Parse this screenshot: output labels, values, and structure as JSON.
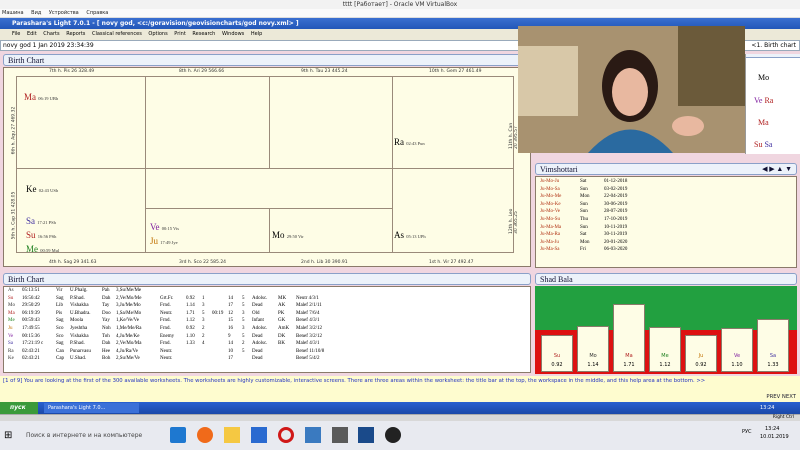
{
  "vbox": {
    "title": "tttt [Работает] - Oracle VM VirtualBox",
    "menu": [
      "Машина",
      "Вид",
      "Устройства",
      "Справка"
    ]
  },
  "app": {
    "title": "Parashara's Light 7.0.1 - [ novy god,  <c:/goravision/geovisioncharts/god novy.xml> ]",
    "menu": [
      "File",
      "Edit",
      "Charts",
      "Reports",
      "Classical references",
      "Options",
      "Print",
      "Research",
      "Windows",
      "Help"
    ],
    "address": "novy god 1 Jan 2019 23:34:39",
    "nav_label": "<1. Birth chart"
  },
  "birth_chart": {
    "title": "Birth Chart",
    "top_headers": [
      "7th h.  Pis  26  328.49",
      "8th h.  Ari  29  566.66",
      "9th h.  Tau  23  445.24",
      "10th h.  Gem  27  461.49"
    ],
    "bottom_headers": [
      "4th h.  Sag  29  341.63",
      "3rd h.  Sco  22  585.24",
      "2nd h.  Lib  30  390.91",
      "1st h.  Vir  27  492.47"
    ],
    "left_headers": [
      "6th h.  Aqu  27  469.32",
      "5th h.  Cap  31  428.05"
    ],
    "right_headers": [
      "11th h.  Can  20  395.57",
      "12th h.  Leo  30  365.25"
    ],
    "planets": [
      {
        "abbr": "Ma",
        "info": "06:19 UBh",
        "color": "#b02020"
      },
      {
        "abbr": "Ra",
        "info": "02:43 Pun",
        "color": "#333"
      },
      {
        "abbr": "Ke",
        "info": "02:43 USh",
        "color": "#333"
      },
      {
        "abbr": "Sa",
        "info": "17:21 PSh",
        "color": "#4030a0"
      },
      {
        "abbr": "Su",
        "info": "16:56 PSh",
        "color": "#b02020"
      },
      {
        "abbr": "Me",
        "info": "00:59 Mul",
        "color": "#208020"
      },
      {
        "abbr": "Ve",
        "info": "00:15 Vis",
        "color": "#8020a0"
      },
      {
        "abbr": "Ju",
        "info": "17:49 Jye",
        "color": "#c07000"
      },
      {
        "abbr": "Mo",
        "info": "29:50 Vir",
        "color": "#333"
      },
      {
        "abbr": "As",
        "info": "05:13 UPh",
        "color": "#333"
      }
    ]
  },
  "side_list": [
    {
      "abbr": "Mo",
      "color": "#333"
    },
    {
      "abbr": "Ve",
      "tail": "Ra",
      "color": "#8020a0"
    },
    {
      "abbr": "Ma",
      "color": "#b02020"
    },
    {
      "abbr": "Su",
      "tail": "Sa",
      "color": "#b02020"
    }
  ],
  "vimshottari": {
    "title": "Vimshottari",
    "rows": [
      [
        "Ju-Mo-Ju",
        "Sat",
        "01-12-2018"
      ],
      [
        "Ju-Mo-Sa",
        "Sun",
        "03-02-2019"
      ],
      [
        "Ju-Mo-Me",
        "Mon",
        "22-04-2019"
      ],
      [
        "Ju-Mo-Ke",
        "Sun",
        "30-06-2019"
      ],
      [
        "Ju-Mo-Ve",
        "Sun",
        "28-07-2019"
      ],
      [
        "Ju-Mo-Su",
        "Thu",
        "17-10-2019"
      ],
      [
        "Ju-Ma-Ma",
        "Sun",
        "10-11-2019"
      ],
      [
        "Ju-Ma-Ra",
        "Sat",
        "30-11-2019"
      ],
      [
        "Ju-Ma-Ju",
        "Mon",
        "20-01-2020"
      ],
      [
        "Ju-Ma-Sa",
        "Fri",
        "06-03-2020"
      ]
    ]
  },
  "table": {
    "title": "Birth Chart",
    "rows": [
      [
        "As",
        "05:13:51",
        "Vir",
        "U.Phalg.",
        "Pah",
        "3,Su/Me/Me",
        "",
        "",
        "",
        "",
        "",
        "",
        "",
        "",
        ""
      ],
      [
        "Su",
        "16:56:42",
        "Sag",
        "P.Shad.",
        "Dah",
        "2,Ve/Mo/Me",
        "Grt.Fr.",
        "0.92",
        "1",
        "",
        "14",
        "5",
        "Adolsc.",
        "MK",
        "Neutr 4/3/1"
      ],
      [
        "Mo",
        "29:50:29",
        "Lib",
        "Vishakha",
        "Tay",
        "3,Ju/Me/Mo",
        "Frnd.",
        "1.14",
        "3",
        "",
        "17",
        "5",
        "Dead",
        "AK",
        "Malef 2/1/11"
      ],
      [
        "Ma",
        "06:19:39",
        "Pis",
        "U.Bhadra.",
        "Doo",
        "1,Sa/Me/Mo",
        "Neutr.",
        "1.71",
        "5",
        "00:19",
        "12",
        "3",
        "Old",
        "PK",
        "Malef 7/6/4"
      ],
      [
        "Me",
        "00:59:43",
        "Sag",
        "Moola",
        "Yay",
        "1,Ke/Ve/Ve",
        "Frnd.",
        "1.12",
        "3",
        "",
        "15",
        "5",
        "Infant",
        "GK",
        "Benef 4/3/1"
      ],
      [
        "Ju",
        "17:49:55",
        "Sco",
        "Jyeshtha",
        "Noh",
        "1,Me/Me/Ra",
        "Frnd.",
        "0.92",
        "2",
        "",
        "16",
        "3",
        "Adolsc.",
        "AmK",
        "Malef 3/2/12"
      ],
      [
        "Ve",
        "00:15:36",
        "Sco",
        "Vishakha",
        "Toh",
        "4,Ju/Me/Ke",
        "Enemy",
        "1.10",
        "2",
        "",
        "9",
        "5",
        "Dead",
        "DK",
        "Benef 3/2/12"
      ],
      [
        "Sa",
        "17:21:19 c",
        "Sag",
        "P.Shad.",
        "Dah",
        "2,Ve/Mo/Ma",
        "Frnd.",
        "1.33",
        "4",
        "",
        "14",
        "2",
        "Adolsc.",
        "BK",
        "Malef 4/3/1"
      ],
      [
        "Ra",
        "02:43:21",
        "Can",
        "Punarvasu",
        "Hee",
        "4,Ju/Ra/Ve",
        "Neutr.",
        "",
        "",
        "",
        "10",
        "5",
        "Dead",
        "",
        "Benef 11/10/8"
      ],
      [
        "Ke",
        "02:43:21",
        "Cap",
        "U.Shad.",
        "Boh",
        "2,Su/Me/Ve",
        "Neutr.",
        "",
        "",
        "",
        "17",
        "",
        "Dead",
        "",
        "Benef 5/4/2"
      ]
    ]
  },
  "shad_bala": {
    "title": "Shad Bala",
    "bars": [
      {
        "planet": "Su",
        "value": 0.92,
        "label": "0.92"
      },
      {
        "planet": "Mo",
        "value": 1.14,
        "label": "1.14"
      },
      {
        "planet": "Ma",
        "value": 1.71,
        "label": "1.71"
      },
      {
        "planet": "Me",
        "value": 1.12,
        "label": "1.12"
      },
      {
        "planet": "Ju",
        "value": 0.92,
        "label": "0.92"
      },
      {
        "planet": "Ve",
        "value": 1.1,
        "label": "1.10"
      },
      {
        "planet": "Sa",
        "value": 1.33,
        "label": "1.33"
      }
    ]
  },
  "help": {
    "text": "[1 of 9] You are looking at the first of the 300 available worksheets. The worksheets are highly customizable, interactive screens. There are three areas within the worksheet: the title bar at the top, the workspace in the middle, and this help area at the bottom. >>",
    "nav": "PREV NEXT"
  },
  "taskbar": {
    "start": "пуск",
    "task": "Parashara's Light 7.0...",
    "time": "13:24",
    "date": "10.01.2019",
    "lang": "РУС"
  },
  "host_taskbar": {
    "search": "Поиск в интернете и на компьютере",
    "time": "13:24",
    "date": "10.01.2019",
    "lang": "РУС",
    "right_ctrl": "Right Ctrl"
  }
}
